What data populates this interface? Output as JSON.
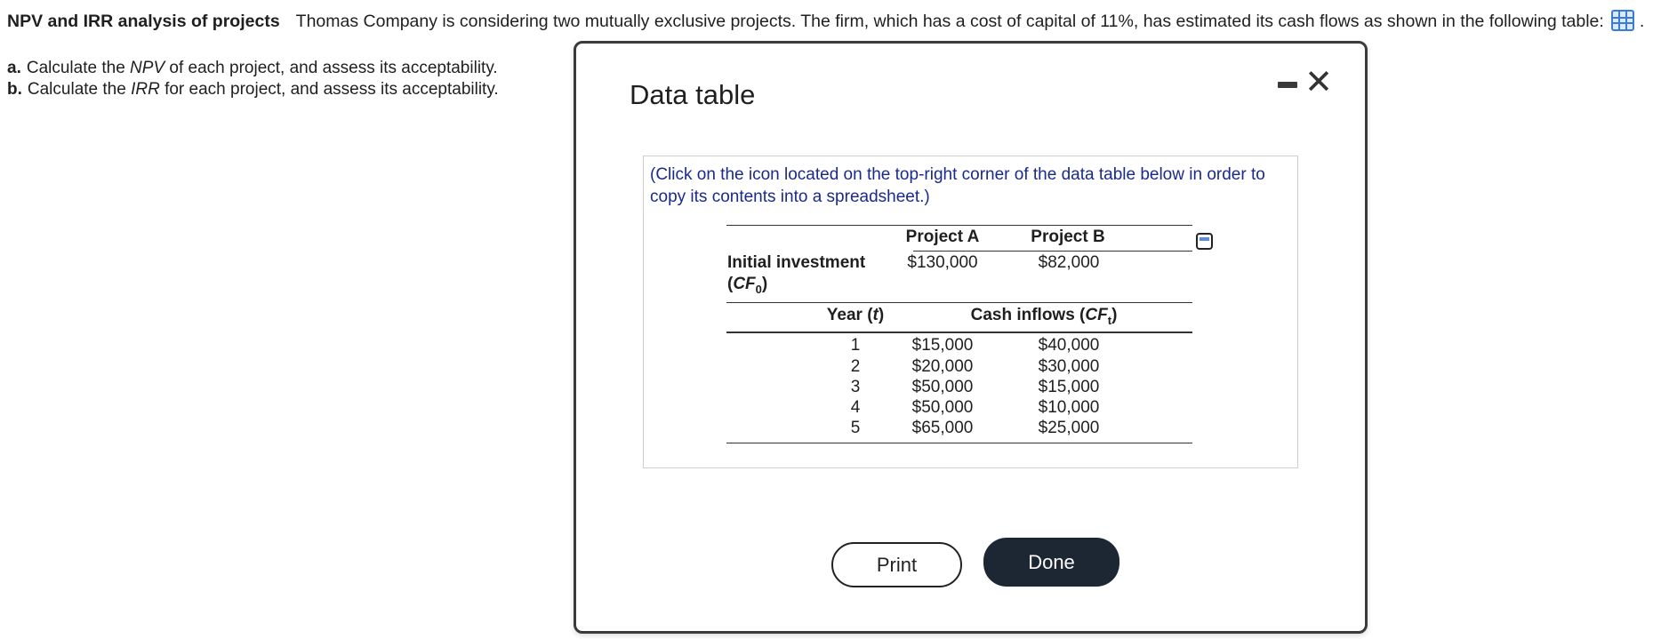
{
  "question": {
    "title": "NPV and IRR analysis of projects",
    "text": "Thomas Company is considering two mutually exclusive projects.  The firm, which has a cost of capital of 11%, has estimated its cash flows as shown in the following table:",
    "trailing": ".",
    "parts": [
      {
        "letter": "a.",
        "pre": "Calculate the ",
        "em": "NPV",
        "post": " of each project, and assess its acceptability."
      },
      {
        "letter": "b.",
        "pre": "Calculate the ",
        "em": "IRR",
        "post": " for each project, and assess its acceptability."
      }
    ]
  },
  "modal": {
    "title": "Data table",
    "instructions": "(Click on the icon located on the top-right corner of the data table below in order to copy its contents into a spreadsheet.)",
    "print_label": "Print",
    "done_label": "Done"
  },
  "table": {
    "project_a": "Project A",
    "project_b": "Project B",
    "initial_label": "Initial investment",
    "cf0_label": "CF",
    "cf0_sub": "0",
    "initial_a": "$130,000",
    "initial_b": "$82,000",
    "year_label_pre": "Year (",
    "year_label_var": "t",
    "year_label_post": ")",
    "inflows_label_pre": "Cash inflows (",
    "inflows_label_var": "CF",
    "inflows_label_sub": "t",
    "inflows_label_post": ")",
    "rows": [
      {
        "year": "1",
        "a": "$15,000",
        "b": "$40,000"
      },
      {
        "year": "2",
        "a": "$20,000",
        "b": "$30,000"
      },
      {
        "year": "3",
        "a": "$50,000",
        "b": "$15,000"
      },
      {
        "year": "4",
        "a": "$50,000",
        "b": "$10,000"
      },
      {
        "year": "5",
        "a": "$65,000",
        "b": "$25,000"
      }
    ]
  },
  "icons": {
    "table_icon": "spreadsheet-grid-icon",
    "minimize": "minimize-icon",
    "close": "close-icon",
    "copy": "copy-to-spreadsheet-icon"
  }
}
